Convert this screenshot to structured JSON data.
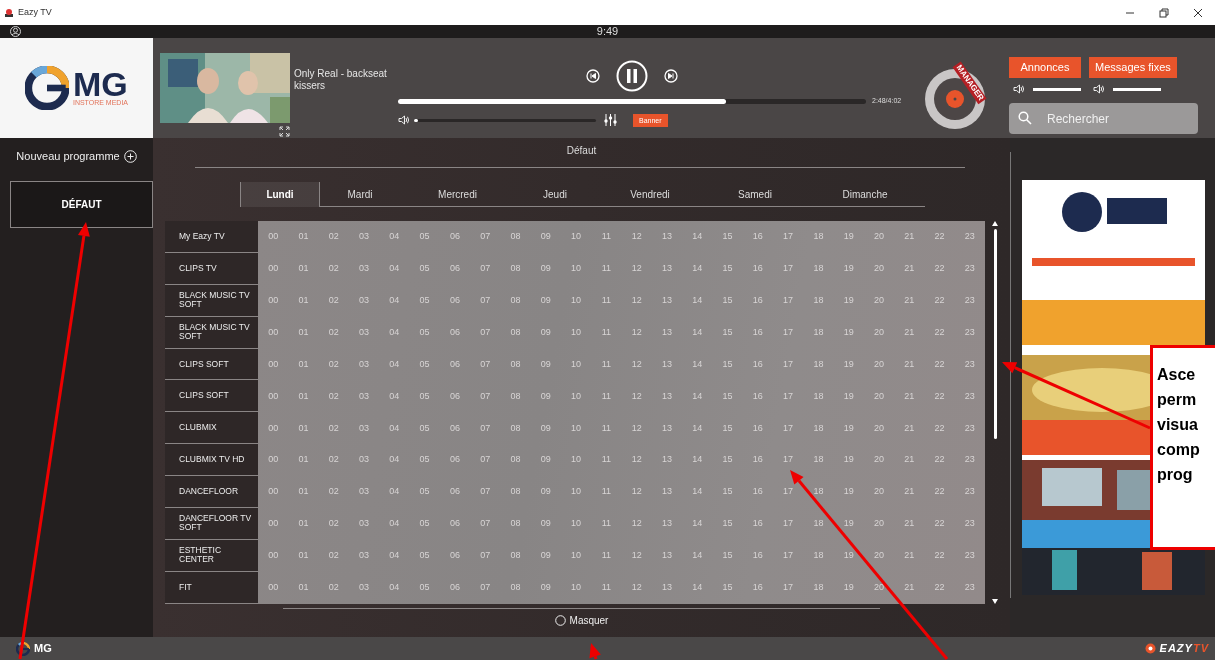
{
  "window": {
    "title": "Eazy TV"
  },
  "top_bar": {
    "time": "9:49"
  },
  "logo": {
    "text": "MG",
    "tagline": "INSTORE MEDIA"
  },
  "player": {
    "title": "Only Real - backseat kissers",
    "playing": true,
    "progress": {
      "level": 0.7
    },
    "time": "2:48/4:02",
    "volume": {
      "level": 0.02
    },
    "banner_button": "Banner"
  },
  "manager": {
    "label": "MANAGER"
  },
  "message_buttons": [
    {
      "label": "Annonces",
      "volume": {
        "level": 1
      }
    },
    {
      "label": "Messages fixes",
      "volume": {
        "level": 1
      }
    }
  ],
  "search": {
    "placeholder": "Rechercher"
  },
  "sidebar": {
    "new_program": "Nouveau programme",
    "programs": [
      {
        "label": "DÉFAUT",
        "selected": true
      }
    ]
  },
  "schedule": {
    "title": "Défaut",
    "tabs": [
      {
        "label": "Lundi",
        "selected": true
      },
      {
        "label": "Mardi",
        "selected": false
      },
      {
        "label": "Mercredi",
        "selected": false
      },
      {
        "label": "Jeudi",
        "selected": false
      },
      {
        "label": "Vendredi",
        "selected": false
      },
      {
        "label": "Samedi",
        "selected": false
      },
      {
        "label": "Dimanche",
        "selected": false
      }
    ],
    "rows": [
      {
        "label": "My Eazy TV",
        "hours": [
          "00",
          "01",
          "02",
          "03",
          "04",
          "05",
          "06",
          "07",
          "08",
          "09",
          "10",
          "11",
          "12",
          "13",
          "14",
          "15",
          "16",
          "17",
          "18",
          "19",
          "20",
          "21",
          "22",
          "23"
        ]
      },
      {
        "label": "CLIPS TV",
        "hours": [
          "00",
          "01",
          "02",
          "03",
          "04",
          "05",
          "06",
          "07",
          "08",
          "09",
          "10",
          "11",
          "12",
          "13",
          "14",
          "15",
          "16",
          "17",
          "18",
          "19",
          "20",
          "21",
          "22",
          "23"
        ]
      },
      {
        "label": "BLACK MUSIC TV SOFT",
        "hours": [
          "00",
          "01",
          "02",
          "03",
          "04",
          "05",
          "06",
          "07",
          "08",
          "09",
          "10",
          "11",
          "12",
          "13",
          "14",
          "15",
          "16",
          "17",
          "18",
          "19",
          "20",
          "21",
          "22",
          "23"
        ]
      },
      {
        "label": "BLACK MUSIC TV SOFT",
        "hours": [
          "00",
          "01",
          "02",
          "03",
          "04",
          "05",
          "06",
          "07",
          "08",
          "09",
          "10",
          "11",
          "12",
          "13",
          "14",
          "15",
          "16",
          "17",
          "18",
          "19",
          "20",
          "21",
          "22",
          "23"
        ]
      },
      {
        "label": "CLIPS SOFT",
        "hours": [
          "00",
          "01",
          "02",
          "03",
          "04",
          "05",
          "06",
          "07",
          "08",
          "09",
          "10",
          "11",
          "12",
          "13",
          "14",
          "15",
          "16",
          "17",
          "18",
          "19",
          "20",
          "21",
          "22",
          "23"
        ]
      },
      {
        "label": "CLIPS SOFT",
        "hours": [
          "00",
          "01",
          "02",
          "03",
          "04",
          "05",
          "06",
          "07",
          "08",
          "09",
          "10",
          "11",
          "12",
          "13",
          "14",
          "15",
          "16",
          "17",
          "18",
          "19",
          "20",
          "21",
          "22",
          "23"
        ]
      },
      {
        "label": "CLUBMIX",
        "hours": [
          "00",
          "01",
          "02",
          "03",
          "04",
          "05",
          "06",
          "07",
          "08",
          "09",
          "10",
          "11",
          "12",
          "13",
          "14",
          "15",
          "16",
          "17",
          "18",
          "19",
          "20",
          "21",
          "22",
          "23"
        ]
      },
      {
        "label": "CLUBMIX TV HD",
        "hours": [
          "00",
          "01",
          "02",
          "03",
          "04",
          "05",
          "06",
          "07",
          "08",
          "09",
          "10",
          "11",
          "12",
          "13",
          "14",
          "15",
          "16",
          "17",
          "18",
          "19",
          "20",
          "21",
          "22",
          "23"
        ]
      },
      {
        "label": "DANCEFLOOR",
        "hours": [
          "00",
          "01",
          "02",
          "03",
          "04",
          "05",
          "06",
          "07",
          "08",
          "09",
          "10",
          "11",
          "12",
          "13",
          "14",
          "15",
          "16",
          "17",
          "18",
          "19",
          "20",
          "21",
          "22",
          "23"
        ]
      },
      {
        "label": "DANCEFLOOR TV SOFT",
        "hours": [
          "00",
          "01",
          "02",
          "03",
          "04",
          "05",
          "06",
          "07",
          "08",
          "09",
          "10",
          "11",
          "12",
          "13",
          "14",
          "15",
          "16",
          "17",
          "18",
          "19",
          "20",
          "21",
          "22",
          "23"
        ]
      },
      {
        "label": "ESTHETIC CENTER",
        "hours": [
          "00",
          "01",
          "02",
          "03",
          "04",
          "05",
          "06",
          "07",
          "08",
          "09",
          "10",
          "11",
          "12",
          "13",
          "14",
          "15",
          "16",
          "17",
          "18",
          "19",
          "20",
          "21",
          "22",
          "23"
        ]
      },
      {
        "label": "FIT",
        "hours": [
          "00",
          "01",
          "02",
          "03",
          "04",
          "05",
          "06",
          "07",
          "08",
          "09",
          "10",
          "11",
          "12",
          "13",
          "14",
          "15",
          "16",
          "17",
          "18",
          "19",
          "20",
          "21",
          "22",
          "23"
        ]
      }
    ],
    "hide_option": {
      "label": "Masquer",
      "checked": false
    }
  },
  "footer": {
    "logo_text": "MG",
    "brand": [
      "EAZY",
      "TV"
    ]
  },
  "callout": {
    "text": "Asce\nperm\nvisua\ncomp\nprog"
  }
}
